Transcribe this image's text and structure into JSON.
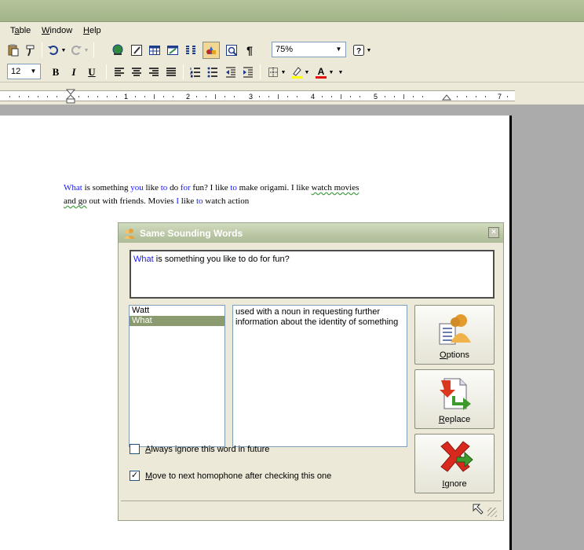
{
  "menu": {
    "items": [
      {
        "key": "table",
        "pre": "T",
        "ul": "a",
        "post": "ble"
      },
      {
        "key": "window",
        "pre": "",
        "ul": "W",
        "post": "indow"
      },
      {
        "key": "help",
        "pre": "",
        "ul": "H",
        "post": "elp"
      }
    ]
  },
  "toolbar": {
    "zoom": "75%",
    "font_size": "12",
    "bold": "B",
    "italic": "I",
    "underline": "U",
    "paragraph_mark": "¶"
  },
  "ruler": {
    "numbers": [
      "1",
      "2",
      "3",
      "4",
      "5",
      "7"
    ]
  },
  "document": {
    "line1": [
      {
        "text": "What",
        "homophone": true
      },
      {
        "text": " is something ",
        "homophone": false
      },
      {
        "text": "you",
        "homophone": true
      },
      {
        "text": " like ",
        "homophone": false
      },
      {
        "text": "to",
        "homophone": true
      },
      {
        "text": " do ",
        "homophone": false
      },
      {
        "text": "for",
        "homophone": true
      },
      {
        "text": " fun? I like ",
        "homophone": false
      },
      {
        "text": "to",
        "homophone": true
      },
      {
        "text": " make origami.  I like ",
        "homophone": false
      },
      {
        "text": "watch movies",
        "homophone": false,
        "squiggle": true
      }
    ],
    "line2": [
      {
        "text": "and go",
        "homophone": false,
        "squiggle": true
      },
      {
        "text": " out with friends. Movies ",
        "homophone": false
      },
      {
        "text": "I",
        "homophone": true
      },
      {
        "text": " like ",
        "homophone": false
      },
      {
        "text": "to",
        "homophone": true
      },
      {
        "text": " watch action",
        "homophone": false
      }
    ]
  },
  "dialog": {
    "title": "Same Sounding Words",
    "close": "×",
    "sentence_word": "What",
    "sentence_rest": " is something you like to do for fun?",
    "words": [
      {
        "text": "Watt",
        "selected": false
      },
      {
        "text": "What",
        "selected": true
      }
    ],
    "definition": "used with a noun in requesting further information about the identity of something",
    "buttons": {
      "options": {
        "ul": "O",
        "rest": "ptions"
      },
      "replace": {
        "ul": "R",
        "rest": "eplace"
      },
      "ignore": {
        "ul": "I",
        "rest": "gnore"
      }
    },
    "checkbox_ignore": {
      "ul": "A",
      "rest": "lways ignore this word in future",
      "checked": false
    },
    "checkbox_next": {
      "ul": "M",
      "rest": "ove to next homophone after checking this one",
      "checked": true
    },
    "check_mark": "✓"
  },
  "colors": {
    "homophone": "#1818ff",
    "selection": "#8c9a70",
    "title_bar": "#b9c6a4"
  }
}
